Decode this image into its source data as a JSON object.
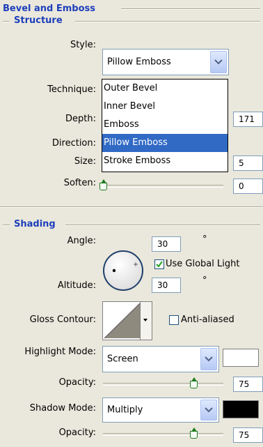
{
  "panel": {
    "title": "Bevel and Emboss",
    "structure": {
      "title": "Structure",
      "style_label": "Style:",
      "style_value": "Pillow Emboss",
      "style_options": [
        "Outer Bevel",
        "Inner Bevel",
        "Emboss",
        "Pillow Emboss",
        "Stroke Emboss"
      ],
      "highlighted_option": "Pillow Emboss",
      "technique_label": "Technique:",
      "depth_label": "Depth:",
      "depth_value": "171",
      "direction_label": "Direction:",
      "size_label": "Size:",
      "size_value": "5",
      "soften_label": "Soften:",
      "soften_value": "0",
      "soften_slider_fraction": 0.0
    },
    "shading": {
      "title": "Shading",
      "angle_label": "Angle:",
      "angle_value": "30",
      "degree_symbol": "°",
      "use_global_light_label": "Use Global Light",
      "use_global_light_checked": true,
      "altitude_label": "Altitude:",
      "altitude_value": "30",
      "gloss_contour_label": "Gloss Contour:",
      "anti_aliased_label": "Anti-aliased",
      "anti_aliased_checked": false,
      "highlight_mode_label": "Highlight Mode:",
      "highlight_mode_value": "Screen",
      "highlight_color": "#ffffff",
      "highlight_opacity_label": "Opacity:",
      "highlight_opacity_value": "75",
      "highlight_opacity_fraction": 0.75,
      "shadow_mode_label": "Shadow Mode:",
      "shadow_mode_value": "Multiply",
      "shadow_color": "#000000",
      "shadow_opacity_label": "Opacity:",
      "shadow_opacity_value": "75",
      "shadow_opacity_fraction": 0.75
    }
  },
  "colors": {
    "title_blue": "#1d3fbb",
    "selection_blue": "#316ac5",
    "panel_bg": "#eae8dc"
  }
}
